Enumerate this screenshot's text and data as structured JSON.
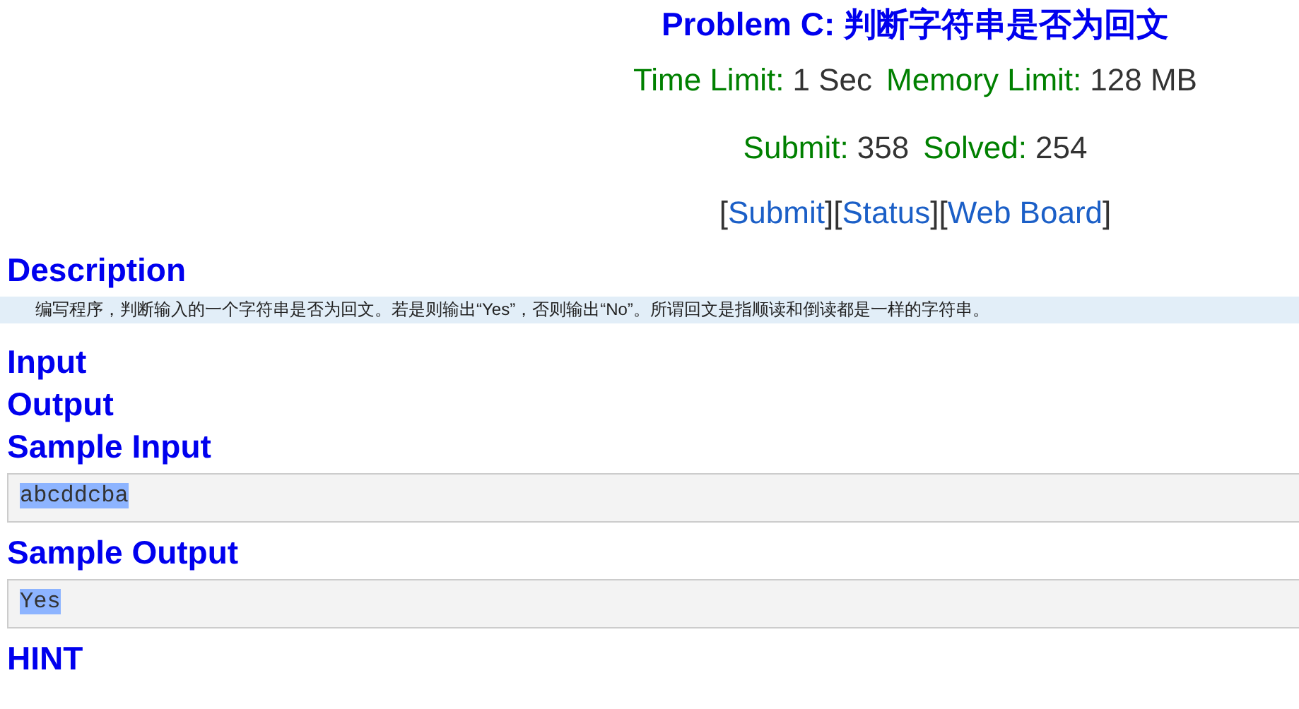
{
  "title": "Problem C: 判断字符串是否为回文",
  "limits": [
    {
      "label": "Time Limit:",
      "value": "1 Sec"
    },
    {
      "label": "Memory Limit:",
      "value": "128 MB"
    }
  ],
  "stats": [
    {
      "label": "Submit:",
      "value": "358"
    },
    {
      "label": "Solved:",
      "value": "254"
    }
  ],
  "links": [
    {
      "open": "[",
      "label": "Submit",
      "close": "]"
    },
    {
      "open": "[",
      "label": "Status",
      "close": "]"
    },
    {
      "open": "[",
      "label": "Web Board",
      "close": "]"
    }
  ],
  "sections": [
    {
      "kind": "text",
      "heading": "Description",
      "body": "编写程序，判断输入的一个字符串是否为回文。若是则输出“Yes”，否则输出“No”。所谓回文是指顺读和倒读都是一样的字符串。"
    },
    {
      "kind": "heading",
      "heading": "Input"
    },
    {
      "kind": "heading",
      "heading": "Output"
    },
    {
      "kind": "sample",
      "heading": "Sample Input",
      "body": "abcddcba",
      "highlighted": true
    },
    {
      "kind": "sample",
      "heading": "Sample Output",
      "body": "Yes",
      "highlighted": true
    },
    {
      "kind": "heading",
      "heading": "HINT"
    }
  ]
}
